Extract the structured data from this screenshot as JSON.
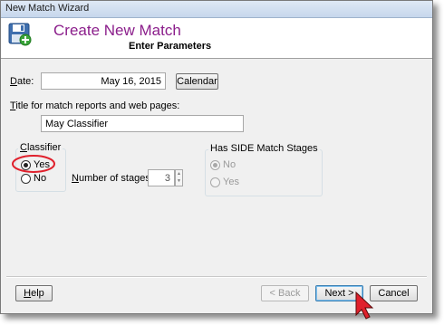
{
  "window": {
    "title": "New Match Wizard"
  },
  "header": {
    "title": "Create New Match",
    "subtitle": "Enter Parameters",
    "icon": "floppy-disk-add-icon"
  },
  "date": {
    "label": "Date:",
    "value": "May 16, 2015",
    "calendar_button": "Calendar"
  },
  "title_field": {
    "label": "Title for match reports and web pages:",
    "value": "May Classifier"
  },
  "classifier": {
    "label": "Classifier",
    "options": [
      "Yes",
      "No"
    ],
    "selected": "Yes"
  },
  "stages": {
    "label": "Number of stages:",
    "value": "3"
  },
  "side_match": {
    "label": "Has SIDE Match Stages",
    "options": [
      "No",
      "Yes"
    ],
    "selected": "No",
    "enabled": false
  },
  "buttons": {
    "help": "Help",
    "back": "< Back",
    "next": "Next >",
    "cancel": "Cancel"
  },
  "colors": {
    "header_title": "#8b1e8b",
    "highlight_ellipse": "#e0202c",
    "cursor": "#e0202c"
  }
}
